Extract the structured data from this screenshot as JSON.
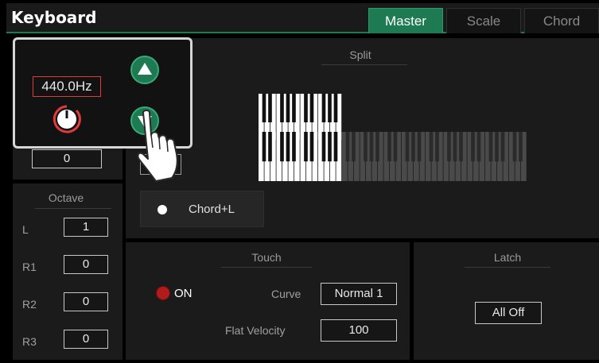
{
  "header": {
    "title": "Keyboard",
    "tabs": [
      {
        "label": "Master",
        "active": true
      },
      {
        "label": "Scale",
        "active": false
      },
      {
        "label": "Chord",
        "active": false
      }
    ]
  },
  "split": {
    "title": "Split",
    "partial_label": "F",
    "chord_option": "Chord+L"
  },
  "transpose": {
    "value": "0"
  },
  "octave": {
    "title": "Octave",
    "rows": [
      {
        "label": "L",
        "value": "1"
      },
      {
        "label": "R1",
        "value": "0"
      },
      {
        "label": "R2",
        "value": "0"
      },
      {
        "label": "R3",
        "value": "0"
      }
    ]
  },
  "touch": {
    "title": "Touch",
    "status": "ON",
    "curve_label": "Curve",
    "curve_value": "Normal 1",
    "flat_velocity_label": "Flat Velocity",
    "flat_velocity_value": "100"
  },
  "latch": {
    "title": "Latch",
    "value": "All Off"
  },
  "tuning_popup": {
    "frequency": "440.0Hz",
    "up_icon": "triangle-up-icon",
    "down_icon": "triangle-down-icon"
  },
  "colors": {
    "accent": "#1d7a52",
    "status_red": "#b01c1c",
    "knob_red": "#e03a3a"
  }
}
